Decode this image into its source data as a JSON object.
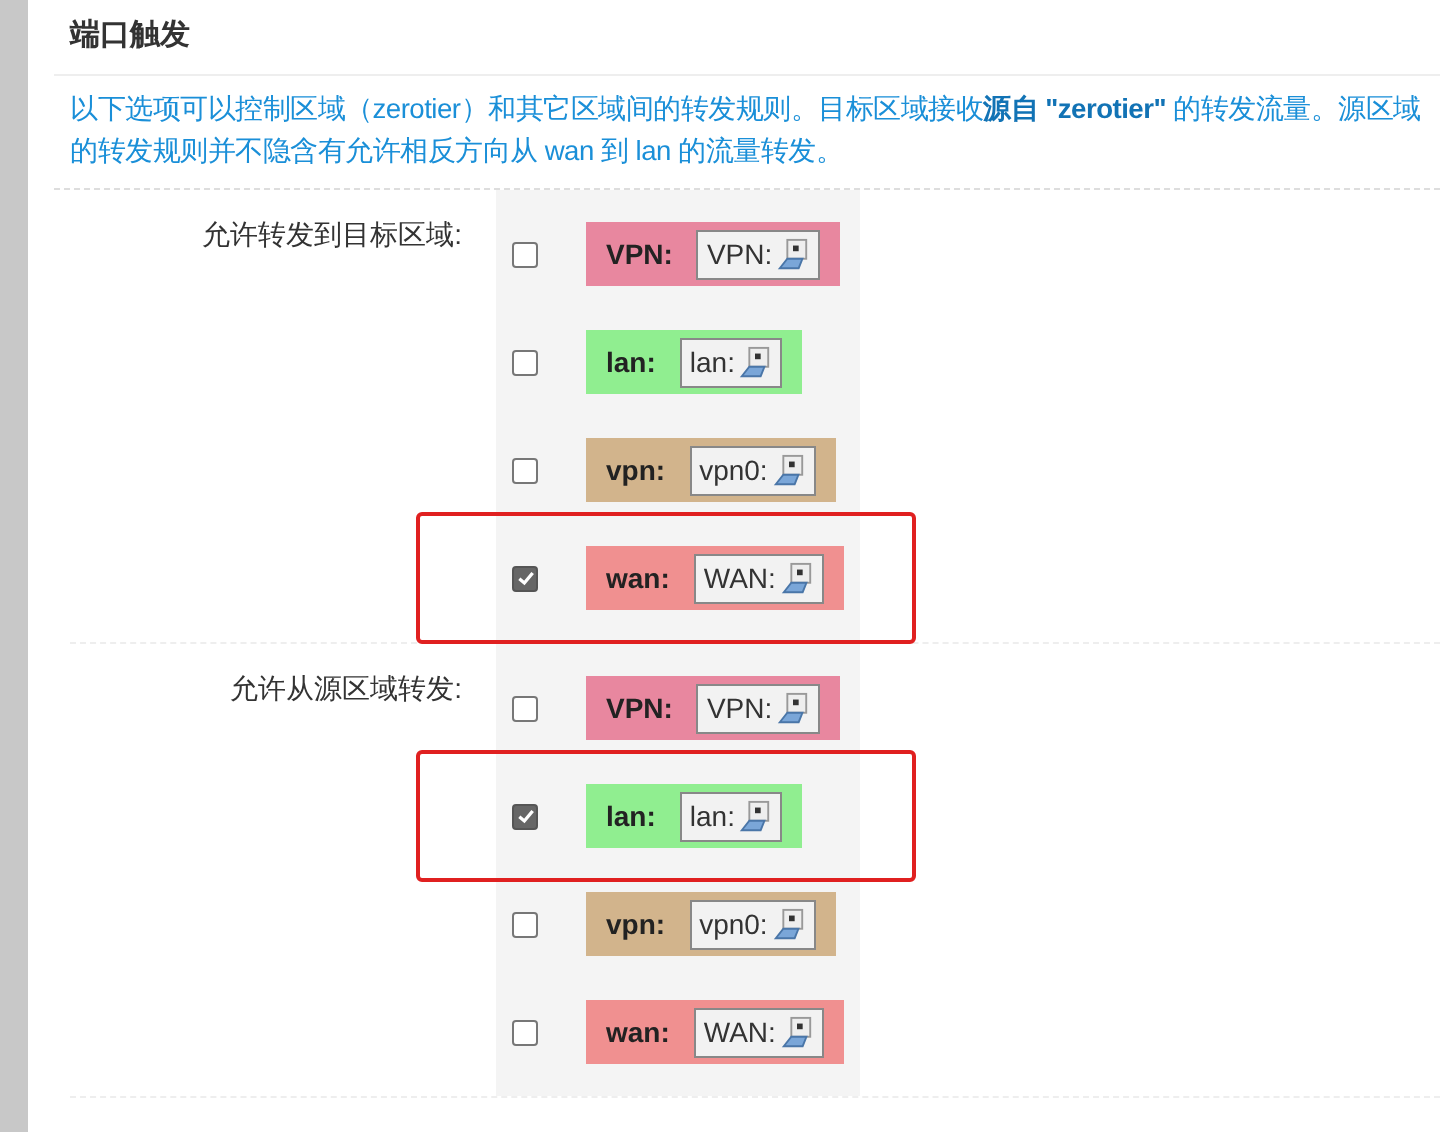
{
  "section": {
    "title": "端口触发",
    "description_lines": [
      "以下选项可以控制区域（zerotier）和其它区域间的转发规则。目标区域接收**源自 \"zerotier\"** 的转发流量。源区域",
      "的转发规则并不隐含有允许相反方向从 wan 到 lan 的流量转发。"
    ]
  },
  "groups": [
    {
      "label": "允许转发到目标区域:",
      "zones": [
        {
          "name": "VPN:",
          "network": "VPN:",
          "color": "#e8879f",
          "checked": false,
          "highlighted": false
        },
        {
          "name": "lan:",
          "network": "lan:",
          "color": "#90ee90",
          "checked": false,
          "highlighted": false
        },
        {
          "name": "vpn:",
          "network": "vpn0:",
          "color": "#d2b48c",
          "checked": false,
          "highlighted": false
        },
        {
          "name": "wan:",
          "network": "WAN:",
          "color": "#f09090",
          "checked": true,
          "highlighted": true
        }
      ]
    },
    {
      "label": "允许从源区域转发:",
      "zones": [
        {
          "name": "VPN:",
          "network": "VPN:",
          "color": "#e8879f",
          "checked": false,
          "highlighted": false
        },
        {
          "name": "lan:",
          "network": "lan:",
          "color": "#90ee90",
          "checked": true,
          "highlighted": true
        },
        {
          "name": "vpn:",
          "network": "vpn0:",
          "color": "#d2b48c",
          "checked": false,
          "highlighted": false
        },
        {
          "name": "wan:",
          "network": "WAN:",
          "color": "#f09090",
          "checked": false,
          "highlighted": false
        }
      ]
    }
  ]
}
